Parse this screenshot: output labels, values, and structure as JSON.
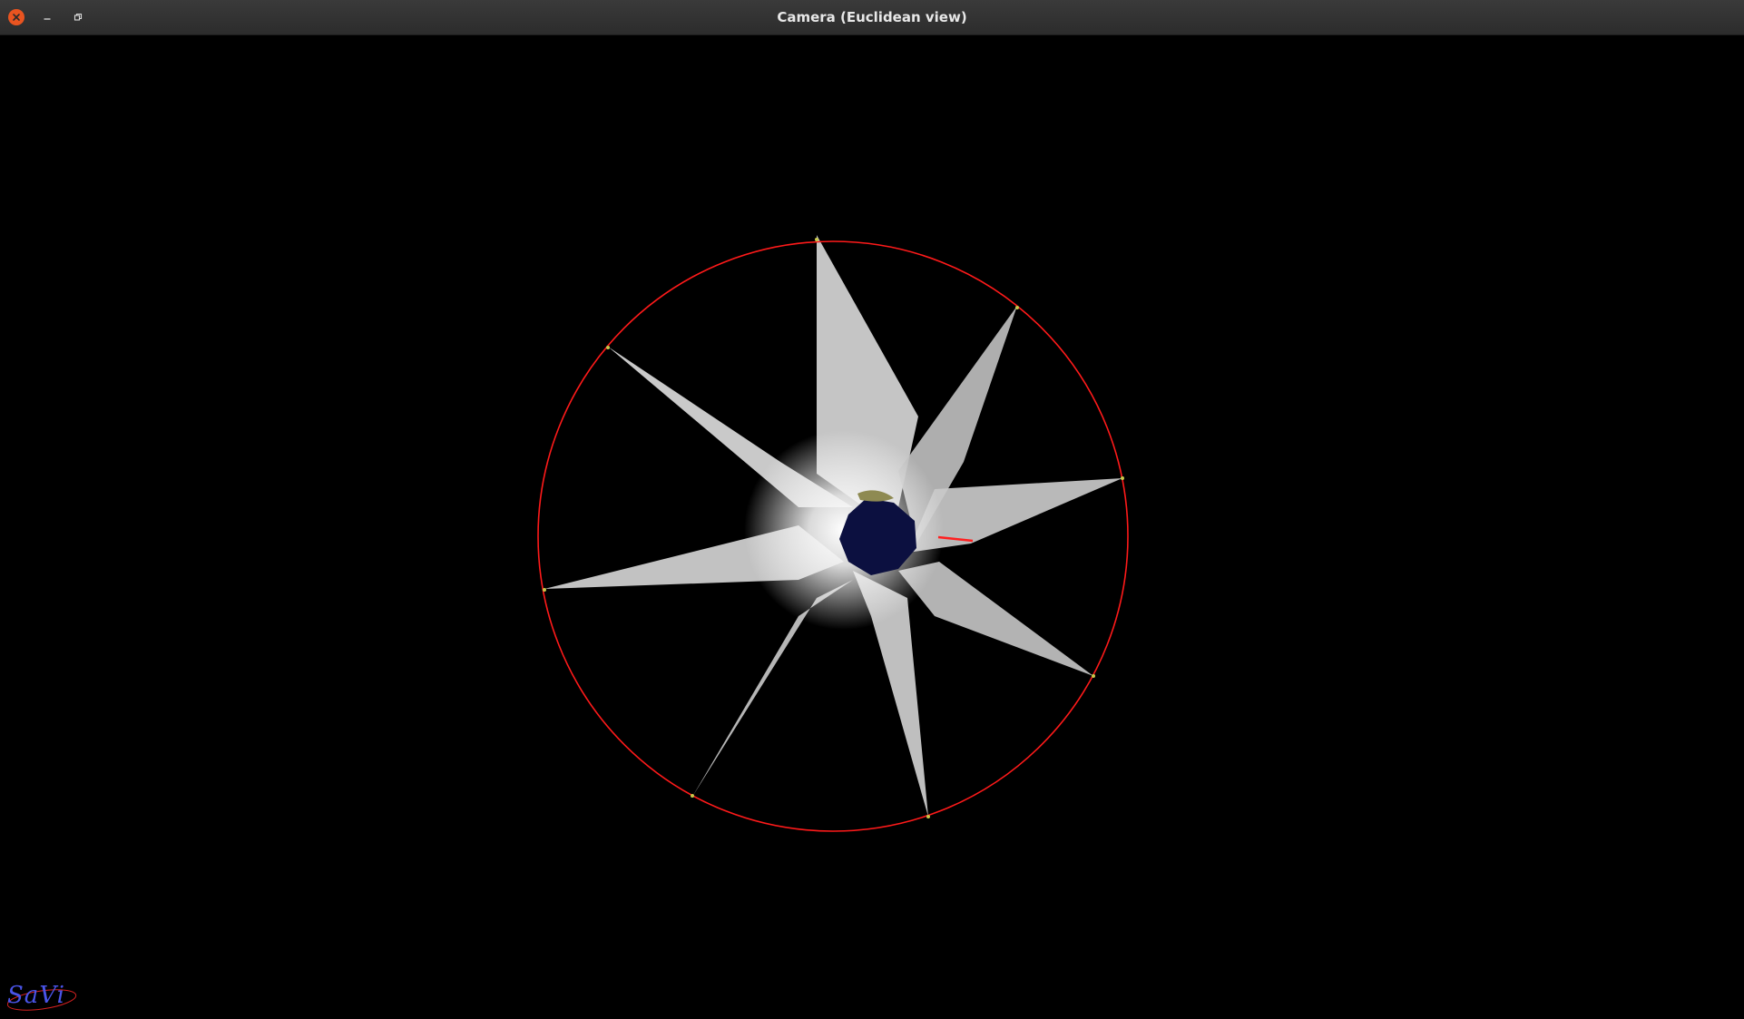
{
  "window": {
    "title": "Camera (Euclidean view)",
    "controls": [
      {
        "name": "close",
        "icon": "close-icon",
        "color": "#e95420"
      },
      {
        "name": "minimize",
        "icon": "minimize-icon"
      },
      {
        "name": "maximize",
        "icon": "restore-icon"
      }
    ]
  },
  "scene": {
    "background": "#000000",
    "star_points": 8,
    "star_color": "#d9d9d9",
    "sphere_color": "#ff1a1a",
    "center_hole_color": "#0c1040",
    "vertex_marker_color": "#c8c84a",
    "ray_color": "#ff2020"
  },
  "logo": {
    "text": "SaVi",
    "color": "#4a54e8",
    "orbit_color": "#d42020"
  }
}
